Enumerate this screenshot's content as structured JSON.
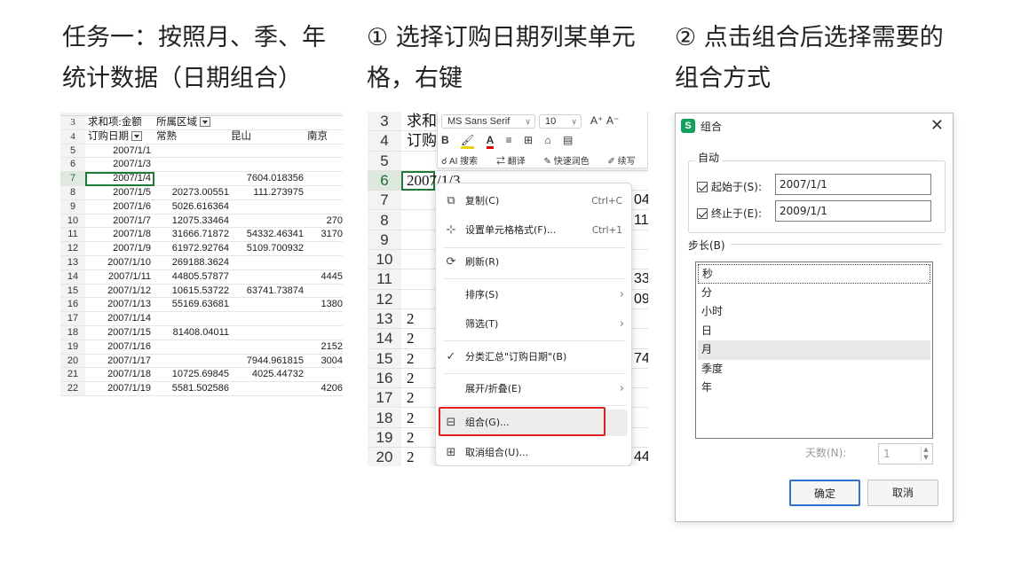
{
  "captions": {
    "step0_line1": "任务一：按照月、季、年",
    "step0_line2": "统计数据（日期组合）",
    "step1_line1": "① 选择订购日期列某单元",
    "step1_line2": "格，右键",
    "step2_line1": "② 点击组合后选择需要的",
    "step2_line2": "组合方式"
  },
  "pivot": {
    "header_row3": {
      "rownum": "3",
      "label": "求和项:金额",
      "field": "所属区域"
    },
    "header_row4": {
      "rownum": "4",
      "label": "订购日期",
      "cols": [
        "常熟",
        "昆山",
        "南京"
      ]
    },
    "rows": [
      {
        "n": "5",
        "date": "2007/1/1",
        "a": "",
        "b": "",
        "c": ""
      },
      {
        "n": "6",
        "date": "2007/1/3",
        "a": "",
        "b": "",
        "c": ""
      },
      {
        "n": "7",
        "date": "2007/1/4",
        "a": "",
        "b": "7604.018356",
        "c": ""
      },
      {
        "n": "8",
        "date": "2007/1/5",
        "a": "20273.00551",
        "b": "111.273975",
        "c": ""
      },
      {
        "n": "9",
        "date": "2007/1/6",
        "a": "5026.616364",
        "b": "",
        "c": ""
      },
      {
        "n": "10",
        "date": "2007/1/7",
        "a": "12075.33464",
        "b": "",
        "c": "270"
      },
      {
        "n": "11",
        "date": "2007/1/8",
        "a": "31666.71872",
        "b": "54332.46341",
        "c": "3170"
      },
      {
        "n": "12",
        "date": "2007/1/9",
        "a": "61972.92764",
        "b": "5109.700932",
        "c": ""
      },
      {
        "n": "13",
        "date": "2007/1/10",
        "a": "269188.3624",
        "b": "",
        "c": ""
      },
      {
        "n": "14",
        "date": "2007/1/11",
        "a": "44805.57877",
        "b": "",
        "c": "4445"
      },
      {
        "n": "15",
        "date": "2007/1/12",
        "a": "10615.53722",
        "b": "63741.73874",
        "c": ""
      },
      {
        "n": "16",
        "date": "2007/1/13",
        "a": "55169.63681",
        "b": "",
        "c": "1380"
      },
      {
        "n": "17",
        "date": "2007/1/14",
        "a": "",
        "b": "",
        "c": ""
      },
      {
        "n": "18",
        "date": "2007/1/15",
        "a": "81408.04011",
        "b": "",
        "c": ""
      },
      {
        "n": "19",
        "date": "2007/1/16",
        "a": "",
        "b": "",
        "c": "2152"
      },
      {
        "n": "20",
        "date": "2007/1/17",
        "a": "",
        "b": "7944.961815",
        "c": "3004"
      },
      {
        "n": "21",
        "date": "2007/1/18",
        "a": "10725.69845",
        "b": "4025.44732",
        "c": ""
      },
      {
        "n": "22",
        "date": "2007/1/19",
        "a": "5581.502586",
        "b": "",
        "c": "4206"
      }
    ]
  },
  "sheet2": {
    "rows": [
      {
        "n": "3",
        "a": "求和",
        "r": ""
      },
      {
        "n": "4",
        "a": "订购",
        "r": ""
      },
      {
        "n": "5",
        "a": "",
        "r": ""
      },
      {
        "n": "6",
        "a": "2007/1/3",
        "r": ""
      },
      {
        "n": "7",
        "a": "",
        "r": "04"
      },
      {
        "n": "8",
        "a": "",
        "r": "11"
      },
      {
        "n": "9",
        "a": "",
        "r": ""
      },
      {
        "n": "10",
        "a": "",
        "r": ""
      },
      {
        "n": "11",
        "a": "",
        "r": "33"
      },
      {
        "n": "12",
        "a": "",
        "r": "09"
      },
      {
        "n": "13",
        "a": "2",
        "r": ""
      },
      {
        "n": "14",
        "a": "2",
        "r": ""
      },
      {
        "n": "15",
        "a": "2",
        "r": "74"
      },
      {
        "n": "16",
        "a": "2",
        "r": ""
      },
      {
        "n": "17",
        "a": "2",
        "r": ""
      },
      {
        "n": "18",
        "a": "2",
        "r": ""
      },
      {
        "n": "19",
        "a": "2",
        "r": ""
      },
      {
        "n": "20",
        "a": "2",
        "r": "44"
      }
    ],
    "mini_toolbar": {
      "font": "MS Sans Serif",
      "size": "10",
      "grow": "A⁺",
      "shrink": "A⁻",
      "bold": "B",
      "ai_search": "AI 搜索",
      "translate": "翻译",
      "quick_color": "快速润色",
      "continue_write": "续写"
    },
    "menu": {
      "copy": "复制(C)",
      "copy_sc": "Ctrl+C",
      "format": "设置单元格格式(F)...",
      "format_sc": "Ctrl+1",
      "refresh": "刷新(R)",
      "sort": "排序(S)",
      "filter": "筛选(T)",
      "subtotal": "分类汇总\"订购日期\"(B)",
      "expand": "展开/折叠(E)",
      "group": "组合(G)...",
      "ungroup": "取消组合(U)..."
    }
  },
  "dialog": {
    "app_icon": "S",
    "title": "组合",
    "close": "✕",
    "auto_label": "自动",
    "start_label": "起始于(S):",
    "start_value": "2007/1/1",
    "end_label": "终止于(E):",
    "end_value": "2009/1/1",
    "step_label": "步长(B)",
    "list": [
      "秒",
      "分",
      "小时",
      "日",
      "月",
      "季度",
      "年"
    ],
    "days_label": "天数(N):",
    "days_value": "1",
    "ok": "确定",
    "cancel": "取消"
  }
}
